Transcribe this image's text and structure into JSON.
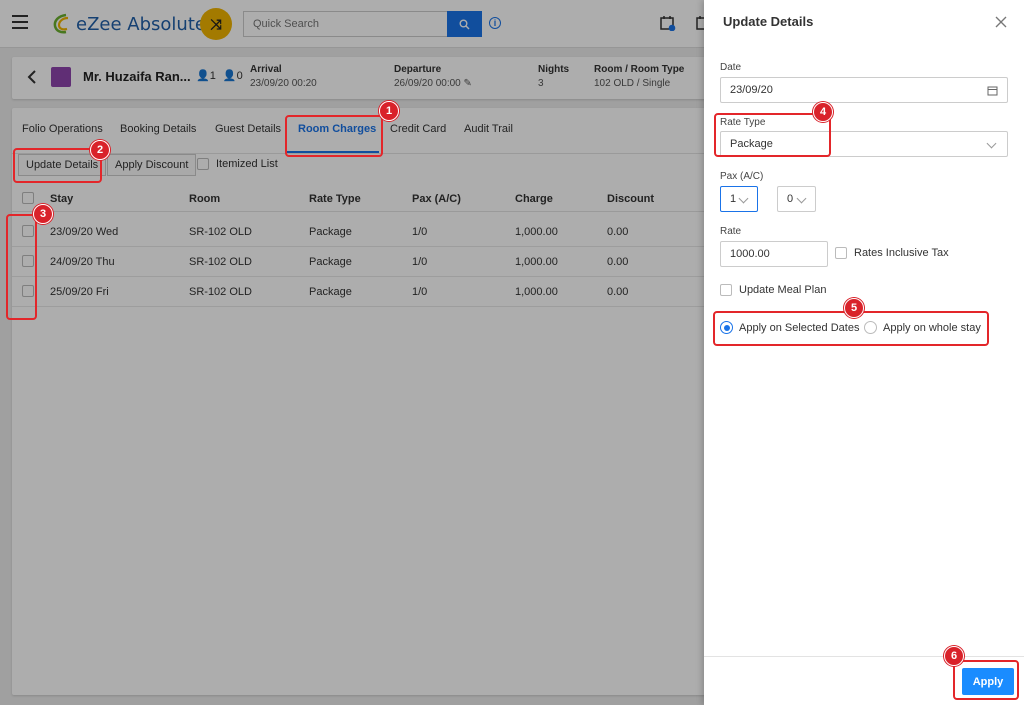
{
  "app": {
    "name": "eZee Absolute",
    "search_placeholder": "Quick Search"
  },
  "guest": {
    "name": "Mr. Huzaifa Ran...",
    "adults": "1",
    "children": "0",
    "arrival_label": "Arrival",
    "arrival_value": "23/09/20 00:20",
    "departure_label": "Departure",
    "departure_value": "26/09/20 00:00",
    "nights_label": "Nights",
    "nights_value": "3",
    "room_label": "Room / Room Type",
    "room_value": "102 OLD / Single"
  },
  "tabs": [
    "Folio Operations",
    "Booking Details",
    "Guest Details",
    "Room Charges",
    "Credit Card",
    "Audit Trail"
  ],
  "active_tab": "Room Charges",
  "toolbar": {
    "update_details": "Update Details",
    "apply_discount": "Apply Discount",
    "itemized_list": "Itemized List"
  },
  "table": {
    "columns": [
      "Stay",
      "Room",
      "Rate Type",
      "Pax (A/C)",
      "Charge",
      "Discount"
    ],
    "rows": [
      [
        "23/09/20 Wed",
        "SR-102 OLD",
        "Package",
        "1/0",
        "1,000.00",
        "0.00"
      ],
      [
        "24/09/20 Thu",
        "SR-102 OLD",
        "Package",
        "1/0",
        "1,000.00",
        "0.00"
      ],
      [
        "25/09/20 Fri",
        "SR-102 OLD",
        "Package",
        "1/0",
        "1,000.00",
        "0.00"
      ]
    ]
  },
  "drawer": {
    "title": "Update Details",
    "date_label": "Date",
    "date_value": "23/09/20",
    "rate_type_label": "Rate Type",
    "rate_type_value": "Package",
    "pax_label": "Pax (A/C)",
    "adults_value": "1",
    "children_value": "0",
    "rate_label": "Rate",
    "rate_value": "1000.00",
    "rates_inclusive_tax": "Rates Inclusive Tax",
    "update_meal_plan": "Update Meal Plan",
    "apply_selected": "Apply on Selected Dates",
    "apply_whole": "Apply on whole stay",
    "apply_button": "Apply"
  },
  "annotations": [
    "1",
    "2",
    "3",
    "4",
    "5",
    "6"
  ],
  "colors": {
    "accent": "#1a73e8",
    "annotation": "#e3262a",
    "logo_badge": "#f0b400"
  }
}
